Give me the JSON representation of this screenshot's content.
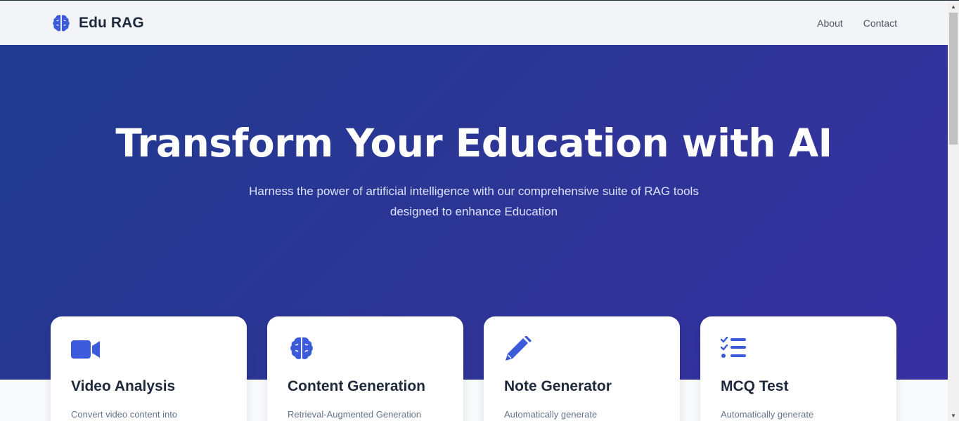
{
  "header": {
    "brand": "Edu RAG",
    "brand_icon": "brain-icon",
    "nav": [
      {
        "label": "About"
      },
      {
        "label": "Contact"
      }
    ]
  },
  "hero": {
    "title": "Transform Your Education with AI",
    "subtitle": "Harness the power of artificial intelligence with our comprehensive suite of RAG tools designed to enhance Education"
  },
  "cards": [
    {
      "icon": "video-camera-icon",
      "title": "Video Analysis",
      "desc": "Convert video content into"
    },
    {
      "icon": "brain-icon",
      "title": "Content Generation",
      "desc": "Retrieval-Augmented Generation"
    },
    {
      "icon": "pencil-icon",
      "title": "Note Generator",
      "desc": "Automatically generate"
    },
    {
      "icon": "checklist-icon",
      "title": "MCQ Test",
      "desc": "Automatically generate"
    }
  ],
  "colors": {
    "accent": "#3b5bdb",
    "hero_start": "#1f3a8f",
    "hero_end": "#3730a3"
  }
}
